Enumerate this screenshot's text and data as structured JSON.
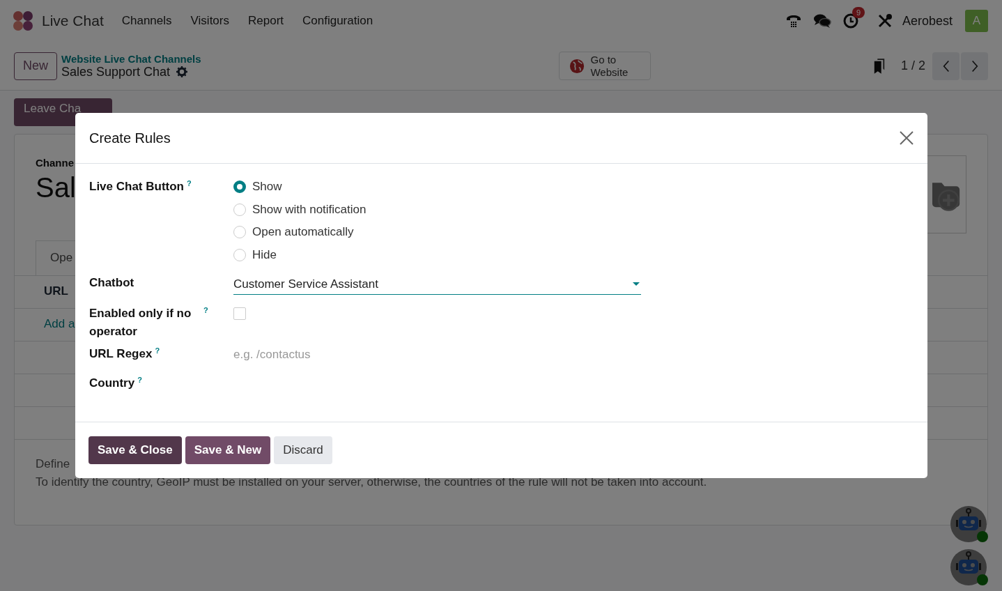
{
  "navbar": {
    "app_name": "Live Chat",
    "menu": [
      "Channels",
      "Visitors",
      "Report",
      "Configuration"
    ],
    "activity_badge": "9",
    "user_name": "Aerobest",
    "avatar_initial": "A"
  },
  "control_panel": {
    "new_button": "New",
    "breadcrumb": "Website Live Chat Channels",
    "record_name": "Sales Support Chat",
    "website_button": "Go to Website",
    "pager": "1 / 2"
  },
  "action_button": "Leave Cha",
  "background_form": {
    "field_label": "Channe",
    "title": "Sal",
    "tab": "Ope",
    "column": "URL",
    "add_link": "Add a",
    "help_line": "Define",
    "help_note": "To identify the country, GeoIP must be installed on your server, otherwise, the countries of the rule will not be taken into account."
  },
  "dialog": {
    "title": "Create Rules",
    "fields": [
      {
        "kind": "radio",
        "label": "Live Chat Button",
        "help": "?",
        "options": [
          {
            "label": "Show",
            "selected": true
          },
          {
            "label": "Show with notification",
            "selected": false
          },
          {
            "label": "Open automatically",
            "selected": false
          },
          {
            "label": "Hide",
            "selected": false
          }
        ]
      },
      {
        "kind": "select",
        "label": "Chatbot",
        "value": "Customer Service Assistant"
      },
      {
        "kind": "checkbox",
        "label": "Enabled only if no operator",
        "help": "?",
        "checked": false
      },
      {
        "kind": "text",
        "label": "URL Regex",
        "help": "?",
        "placeholder": "e.g. /contactus"
      },
      {
        "kind": "text",
        "label": "Country",
        "help": "?"
      }
    ],
    "buttons": [
      {
        "label": "Save & Close",
        "kind": "primary"
      },
      {
        "label": "Save & New",
        "kind": "secondary"
      },
      {
        "label": "Discard",
        "kind": "light"
      }
    ]
  }
}
